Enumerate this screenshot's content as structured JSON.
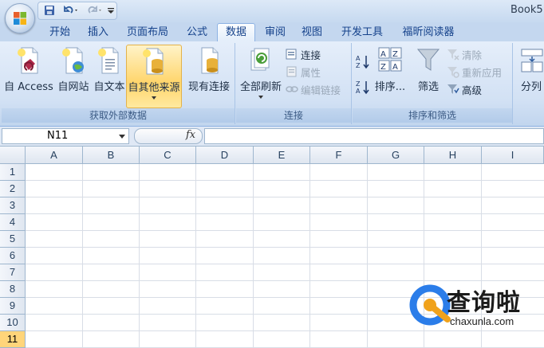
{
  "window": {
    "title": "Book5"
  },
  "quick_access": {
    "icons": [
      "save-icon",
      "undo-icon",
      "redo-icon",
      "customize-icon"
    ]
  },
  "tabs": [
    {
      "label": "开始",
      "active": false
    },
    {
      "label": "插入",
      "active": false
    },
    {
      "label": "页面布局",
      "active": false
    },
    {
      "label": "公式",
      "active": false
    },
    {
      "label": "数据",
      "active": true
    },
    {
      "label": "审阅",
      "active": false
    },
    {
      "label": "视图",
      "active": false
    },
    {
      "label": "开发工具",
      "active": false
    },
    {
      "label": "福昕阅读器",
      "active": false
    }
  ],
  "ribbon": {
    "get_external": {
      "label": "获取外部数据",
      "from_access": "自 Access",
      "from_web": "自网站",
      "from_text": "自文本",
      "from_other": "自其他来源",
      "existing": "现有连接"
    },
    "connections": {
      "label": "连接",
      "refresh_all": "全部刷新",
      "connections": "连接",
      "properties": "属性",
      "edit_links": "编辑链接"
    },
    "sort_filter": {
      "label": "排序和筛选",
      "sort": "排序...",
      "filter": "筛选",
      "clear": "清除",
      "reapply": "重新应用",
      "advanced": "高级"
    },
    "data_tools": {
      "text_to_columns": "分列"
    }
  },
  "formula_bar": {
    "name_box": "N11",
    "fx": "fx",
    "formula": ""
  },
  "sheet": {
    "columns": [
      "A",
      "B",
      "C",
      "D",
      "E",
      "F",
      "G",
      "H",
      "I"
    ],
    "rows": [
      "1",
      "2",
      "3",
      "4",
      "5",
      "6",
      "7",
      "8",
      "9",
      "10",
      "11"
    ],
    "active_row": "11"
  },
  "watermark": {
    "text": "查询啦",
    "url": "chaxunla.com"
  },
  "colors": {
    "accent": "#15428b",
    "active_row": "#ffd57a",
    "highlight": "#ffd56b"
  }
}
